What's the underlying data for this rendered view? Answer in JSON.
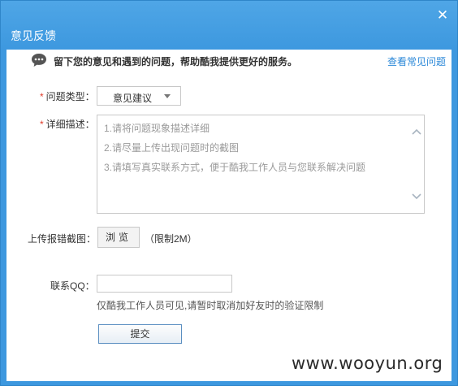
{
  "window": {
    "title": "意见反馈",
    "close_icon": "close-icon"
  },
  "notice": {
    "icon": "chat-bubble-icon",
    "text": "留下您的意见和遇到的问题，帮助酷我提供更好的服务。",
    "faq_link": "查看常见问题"
  },
  "form": {
    "type_label": "问题类型：",
    "type_value": "意见建议",
    "detail_label": "详细描述：",
    "detail_placeholder": [
      "1.请将问题现象描述详细",
      "2.请尽量上传出现问题时的截图",
      "3.请填写真实联系方式，便于酷我工作人员与您联系解决问题"
    ],
    "upload_label": "上传报错截图：",
    "browse_button": "浏览",
    "upload_limit": "（限制2M）",
    "qq_label": "联系QQ：",
    "qq_value": "",
    "qq_hint": "仅酷我工作人员可见,请暂时取消加好友时的验证限制",
    "submit_button": "提交",
    "required_mark": "*"
  },
  "watermark": "www.wooyun.org",
  "colors": {
    "titlebar": "#3d98df",
    "link": "#2b88d8",
    "required": "#e03c2b"
  }
}
